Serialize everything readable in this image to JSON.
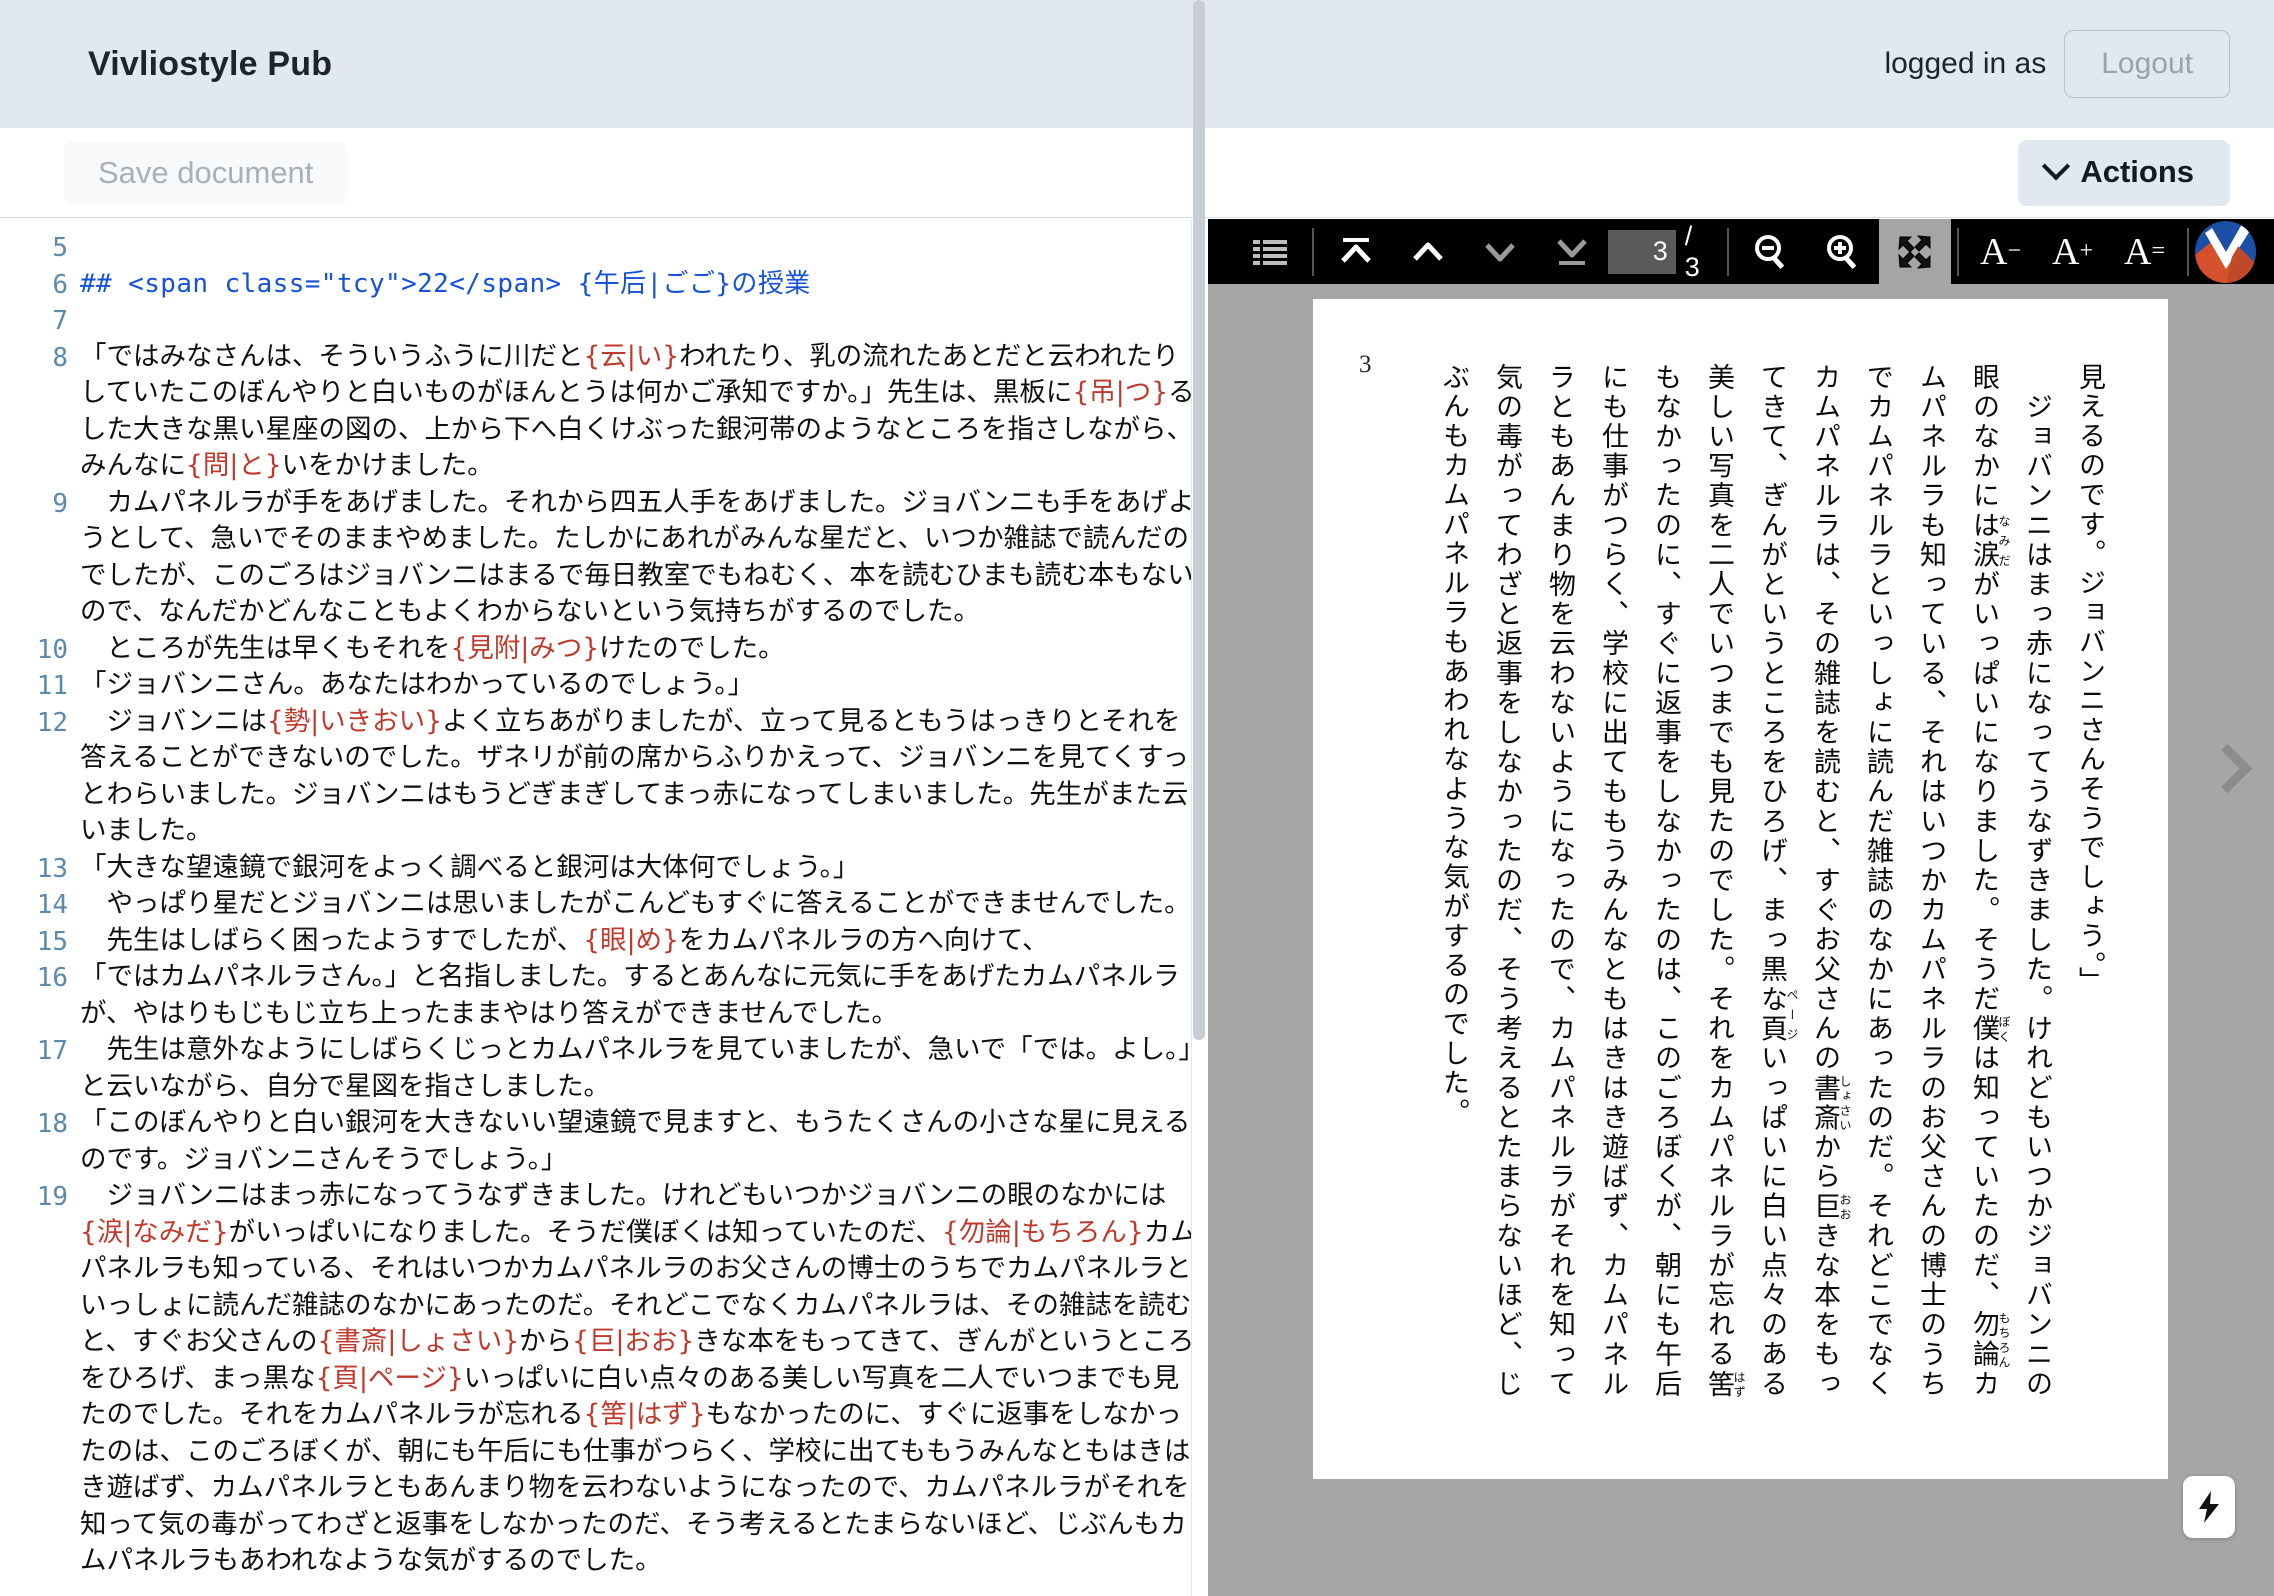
{
  "header": {
    "brand": "Vivliostyle Pub",
    "logged_in_label": "logged in as",
    "logout_label": "Logout"
  },
  "toolbar": {
    "save_label": "Save document",
    "actions_label": "Actions"
  },
  "editor": {
    "lines": [
      {
        "num": "5",
        "type": "blank",
        "text": ""
      },
      {
        "num": "6",
        "type": "markdown",
        "text": "## <span class=\"tcy\">22</span> {午后|ごご}の授業"
      },
      {
        "num": "7",
        "type": "blank",
        "text": ""
      },
      {
        "num": "8",
        "type": "text",
        "text": "「ではみなさんは、そういうふうに川だと{云|い}われたり、乳の流れたあとだと云われたりしていたこのぼんやりと白いものがほんとうは何かご承知ですか。」先生は、黒板に{吊|つ}るした大きな黒い星座の図の、上から下へ白くけぶった銀河帯のようなところを指さしながら、みんなに{問|と}いをかけました。"
      },
      {
        "num": "9",
        "type": "text",
        "text": "　カムパネルラが手をあげました。それから四五人手をあげました。ジョバンニも手をあげようとして、急いでそのままやめました。たしかにあれがみんな星だと、いつか雑誌で読んだのでしたが、このごろはジョバンニはまるで毎日教室でもねむく、本を読むひまも読む本もないので、なんだかどんなこともよくわからないという気持ちがするのでした。"
      },
      {
        "num": "10",
        "type": "text",
        "text": "　ところが先生は早くもそれを{見附|みつ}けたのでした。"
      },
      {
        "num": "11",
        "type": "text",
        "text": "「ジョバンニさん。あなたはわかっているのでしょう。」"
      },
      {
        "num": "12",
        "type": "text",
        "text": "　ジョバンニは{勢|いきおい}よく立ちあがりましたが、立って見るともうはっきりとそれを答えることができないのでした。ザネリが前の席からふりかえって、ジョバンニを見てくすっとわらいました。ジョバンニはもうどぎまぎしてまっ赤になってしまいました。先生がまた云いました。"
      },
      {
        "num": "13",
        "type": "text",
        "text": "「大きな望遠鏡で銀河をよっく調べると銀河は大体何でしょう。」"
      },
      {
        "num": "14",
        "type": "text",
        "text": "　やっぱり星だとジョバンニは思いましたがこんどもすぐに答えることができませんでした。"
      },
      {
        "num": "15",
        "type": "text",
        "text": "　先生はしばらく困ったようすでしたが、{眼|め}をカムパネルラの方へ向けて、"
      },
      {
        "num": "16",
        "type": "text",
        "text": "「ではカムパネルラさん。」と名指しました。するとあんなに元気に手をあげたカムパネルラが、やはりもじもじ立ち上ったままやはり答えができませんでした。"
      },
      {
        "num": "17",
        "type": "text",
        "text": "　先生は意外なようにしばらくじっとカムパネルラを見ていましたが、急いで「では。よし。」と云いながら、自分で星図を指さしました。"
      },
      {
        "num": "18",
        "type": "text",
        "text": "「このぼんやりと白い銀河を大きないい望遠鏡で見ますと、もうたくさんの小さな星に見えるのです。ジョバンニさんそうでしょう。」"
      },
      {
        "num": "19",
        "type": "text",
        "text": "　ジョバンニはまっ赤になってうなずきました。けれどもいつかジョバンニの眼のなかには{涙|なみだ}がいっぱいになりました。そうだ僕ぼくは知っていたのだ、{勿論|もちろん}カムパネルラも知っている、それはいつかカムパネルラのお父さんの博士のうちでカムパネルラといっしょに読んだ雑誌のなかにあったのだ。それどこでなくカムパネルラは、その雑誌を読むと、すぐお父さんの{書斎|しょさい}から{巨|おお}きな本をもってきて、ぎんがというところをひろげ、まっ黒な{頁|ページ}いっぱいに白い点々のある美しい写真を二人でいつまでも見たのでした。それをカムパネルラが忘れる{筈|はず}もなかったのに、すぐに返事をしなかったのは、このごろぼくが、朝にも午后にも仕事がつらく、学校に出てももうみんなともはきはき遊ばず、カムパネルラともあんまり物を云わないようになったので、カムパネルラがそれを知って気の毒がってわざと返事をしなかったのだ、そう考えるとたまらないほど、じぶんもカムパネルラもあわれなような気がするのでした。"
      }
    ]
  },
  "preview": {
    "toolbar": {
      "toc_icon": "list-icon",
      "first_page_icon": "first-page-icon",
      "prev_page_icon": "prev-page-icon",
      "next_page_icon": "next-page-icon",
      "last_page_icon": "last-page-icon",
      "page_current": "3",
      "page_total": "/ 3",
      "zoom_out_icon": "zoom-out-icon",
      "zoom_in_icon": "zoom-in-icon",
      "fit_icon": "fit-to-screen-icon",
      "font_smaller_label": "A",
      "font_smaller_sup": "−",
      "font_larger_label": "A",
      "font_larger_sup": "+",
      "font_reset_label": "A",
      "font_reset_sup": "=",
      "logo_icon": "vivliostyle-logo-icon"
    },
    "page": {
      "folio": "3",
      "body": "見えるのです。ジョバンニさんそうでしょう。」\n　ジョバンニはまっ赤になってうなずきました。けれどもいつかジョバンニの眼のなかには涙（なみだ）がいっぱいになりました。そうだ僕（ぼく）は知っていたのだ、勿論（もちろん）カムパネルラも知っている、それはいつかカムパネルラのお父さんの博士のうちでカムパネルラといっしょに読んだ雑誌のなかにあったのだ。それどこでなくカムパネルラは、その雑誌を読むと、すぐお父さんの書斎（しょさい）から巨（おお）きな本をもってきて、ぎんがというところをひろげ、まっ黒な頁（ページ）いっぱいに白い点々のある美しい写真を二人でいつまでも見たのでした。それをカムパネルラが忘れる筈（はず）もなかったのに、すぐに返事をしなかったのは、このごろぼくが、朝にも午后にも仕事がつらく、学校に出てももうみんなともはきはき遊ばず、カムパネルラともあんまり物を云わないようになったので、カムパネルラがそれを知って気の毒がってわざと返事をしなかったのだ、そう考えるとたまらないほど、じぶんもカムパネルラもあわれなような気がするのでした。"
    },
    "next_page_arrow_icon": "chevron-right-icon",
    "bolt_badge_icon": "lightning-bolt-icon"
  },
  "colors": {
    "header_bg": "#e2e8ef",
    "ruby_red": "#c0392b",
    "markdown_blue": "#1552d8",
    "gutter_blue": "#5b8aab",
    "preview_bg": "#a6a6a6",
    "toolbar_bg": "#000000"
  }
}
